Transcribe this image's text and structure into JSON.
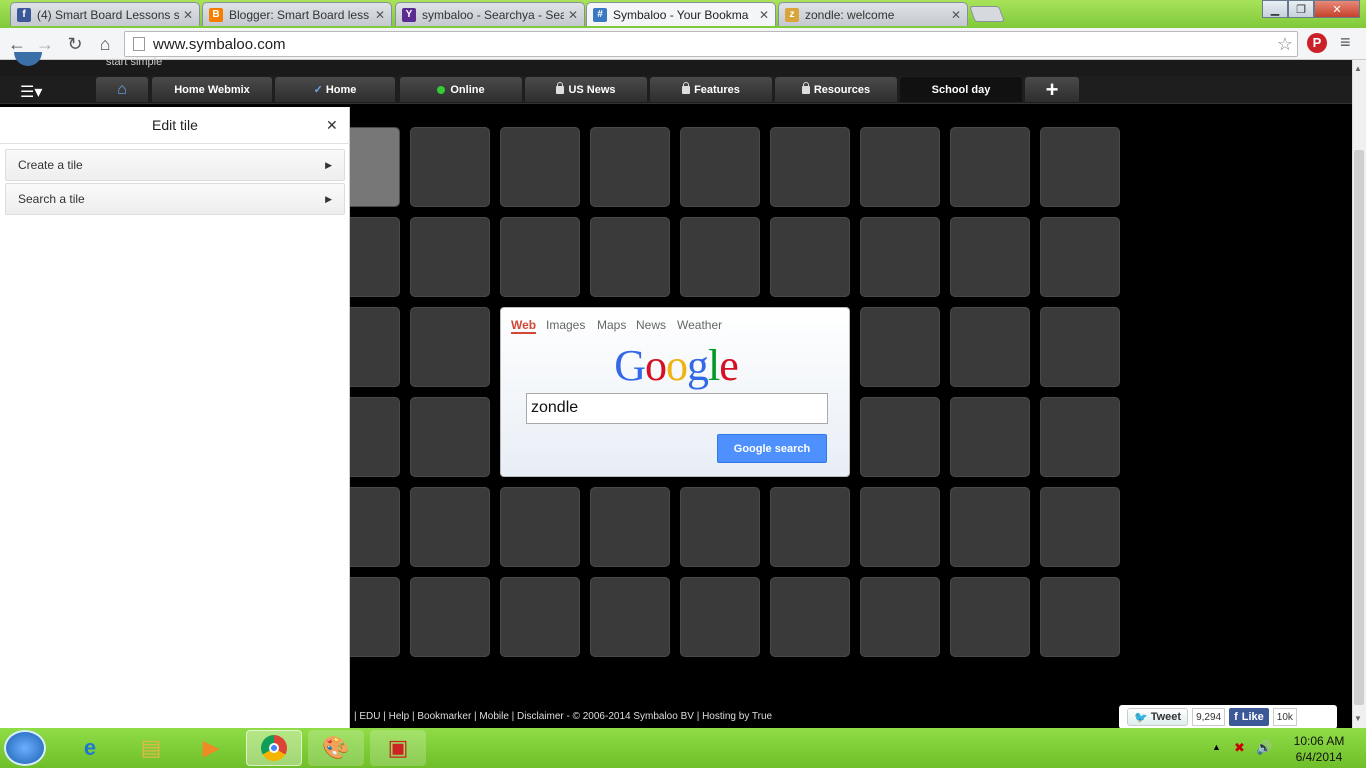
{
  "browser": {
    "tabs": [
      {
        "label": "(4) Smart Board Lessons sl",
        "icon": "facebook-icon",
        "color": "#3b5998",
        "glyph": "f"
      },
      {
        "label": "Blogger: Smart Board less",
        "icon": "blogger-icon",
        "color": "#f57d00",
        "glyph": "B"
      },
      {
        "label": "symbaloo - Searchya - Sea",
        "icon": "yahoo-icon",
        "color": "#5c2d91",
        "glyph": "Y"
      },
      {
        "label": "Symbaloo - Your Bookma",
        "icon": "symbaloo-icon",
        "color": "#3a78c2",
        "glyph": "#"
      },
      {
        "label": "zondle: welcome",
        "icon": "zondle-icon",
        "color": "#d9a53a",
        "glyph": "z"
      }
    ],
    "url": "www.symbaloo.com"
  },
  "symbaloo": {
    "slogan": "start simple",
    "nav_tabs": [
      {
        "label": "Home Webmix"
      },
      {
        "label": "Home"
      },
      {
        "label": "Online"
      },
      {
        "label": "US News"
      },
      {
        "label": "Features"
      },
      {
        "label": "Resources"
      },
      {
        "label": "School day"
      }
    ]
  },
  "panel": {
    "title": "Edit tile",
    "items": [
      {
        "label": "Create a tile"
      },
      {
        "label": "Search a tile"
      }
    ]
  },
  "google": {
    "tabs": [
      "Web",
      "Images",
      "Maps",
      "News",
      "Weather"
    ],
    "query": "zondle",
    "button": "Google search"
  },
  "footer": {
    "text": "|   EDU   |   Help   |   Bookmarker   |   Mobile   |   Disclaimer   -    © 2006-2014 Symbaloo BV    |   Hosting by True"
  },
  "social": {
    "tweet": "Tweet",
    "tweet_count": "9,294",
    "like": "Like",
    "like_count": "10k"
  },
  "taskbar": {
    "time": "10:06 AM",
    "date": "6/4/2014"
  }
}
